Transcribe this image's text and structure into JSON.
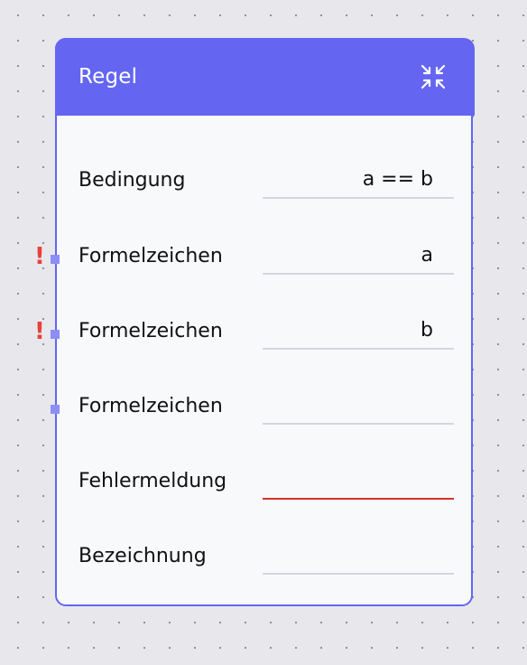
{
  "node": {
    "title": "Regel",
    "collapse_icon": "collapse-icon",
    "accent_color": "#6466f1",
    "fields": [
      {
        "label": "Bedingung",
        "value": "a == b",
        "has_port": false,
        "warning": false
      },
      {
        "label": "Formelzeichen",
        "value": "a",
        "has_port": true,
        "warning": true,
        "warning_glyph": "!"
      },
      {
        "label": "Formelzeichen",
        "value": "b",
        "has_port": true,
        "warning": true,
        "warning_glyph": "!"
      },
      {
        "label": "Formelzeichen",
        "value": "",
        "has_port": true,
        "warning": false
      },
      {
        "label": "Fehlermeldung",
        "value": "",
        "has_port": false,
        "warning": false,
        "error": true
      },
      {
        "label": "Bezeichnung",
        "value": "",
        "has_port": false,
        "warning": false
      }
    ]
  }
}
